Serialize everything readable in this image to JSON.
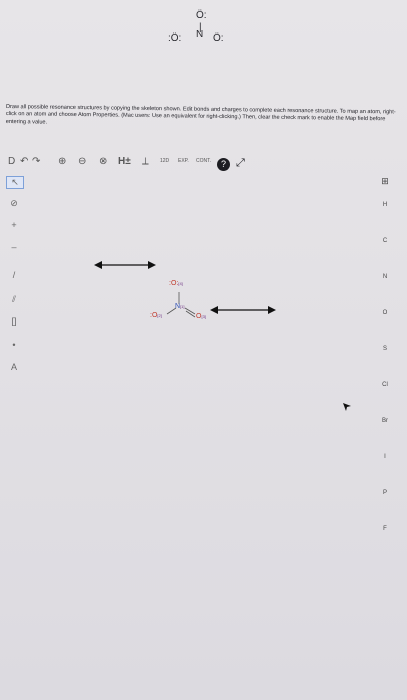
{
  "top_molecule": {
    "top_o": "Ö:",
    "bond": "|",
    "left_o": ":Ö:",
    "n": "N",
    "right_o": "Ö:"
  },
  "instructions": "Draw all possible resonance structures by copying the skeleton shown. Edit bonds and charges to complete each resonance structure. To map an atom, right-click on an atom and choose Atom Properties. (Mac users: Use an equivalent for right-clicking.) Then, clear the check mark to enable the Map field before entering a value.",
  "toolbar": {
    "new": "D",
    "undo": "↶",
    "redo": "↷",
    "zoom_in": "⊕",
    "zoom_out": "⊖",
    "clear": "⊗",
    "hplus": "H±",
    "templates": "⟂",
    "t1": "12D",
    "t2": "EXP.",
    "t3": "CONT.",
    "help": "?",
    "expand": "⤢"
  },
  "left_tools": [
    "↖",
    "⊘",
    "+",
    "–",
    "/",
    "⫽",
    "[]",
    "•",
    "A"
  ],
  "right_atoms": [
    "H",
    "C",
    "N",
    "O",
    "S",
    "Cl",
    "Br",
    "I",
    "P",
    "F"
  ],
  "periodic": "⊞",
  "canvas_molecule": {
    "top_o": ":O:",
    "top_o_sub": "[4]",
    "n": "N",
    "n_sub": "[1]",
    "left_o": ":O",
    "left_o_sub": "[2]",
    "right_o": "O",
    "right_o_sub": "[3]"
  }
}
